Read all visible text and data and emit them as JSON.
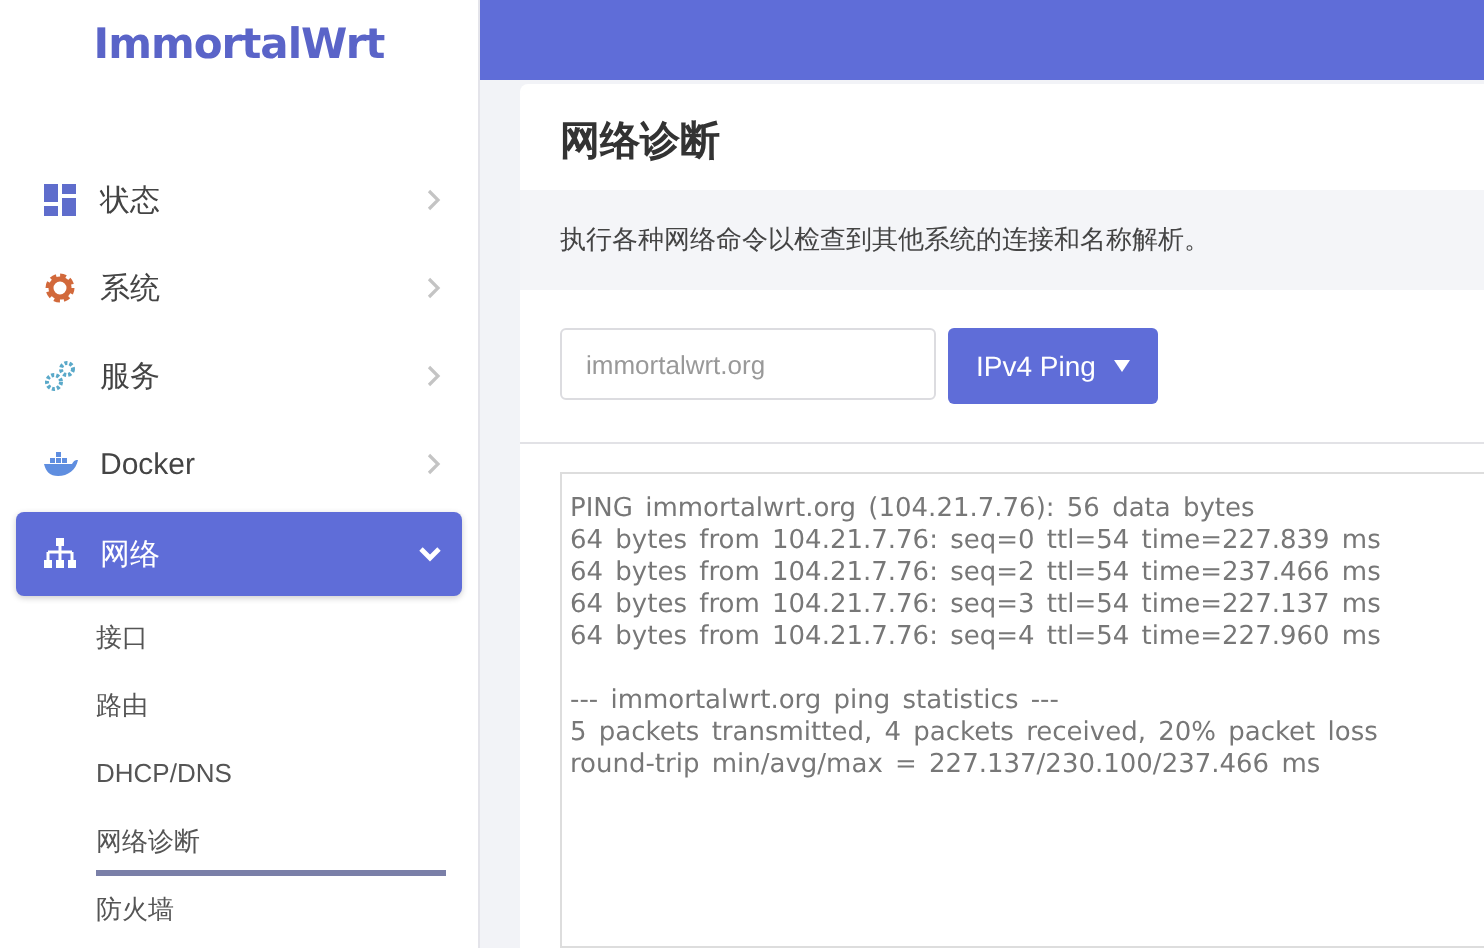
{
  "logo": "ImmortalWrt",
  "sidebar": {
    "items": [
      {
        "label": "状态",
        "expanded": false,
        "selected": false
      },
      {
        "label": "系统",
        "expanded": false,
        "selected": false
      },
      {
        "label": "服务",
        "expanded": false,
        "selected": false
      },
      {
        "label": "Docker",
        "expanded": false,
        "selected": false
      },
      {
        "label": "网络",
        "expanded": true,
        "selected": true,
        "children": [
          {
            "label": "接口",
            "selected": false
          },
          {
            "label": "路由",
            "selected": false
          },
          {
            "label": "DHCP/DNS",
            "selected": false
          },
          {
            "label": "网络诊断",
            "selected": true
          },
          {
            "label": "防火墙",
            "selected": false
          }
        ]
      }
    ]
  },
  "page": {
    "title": "网络诊断",
    "description": "执行各种网络命令以检查到其他系统的连接和名称解析。",
    "host_field": {
      "value": "immortalwrt.org"
    },
    "command_button": {
      "label": "IPv4 Ping"
    },
    "output": "PING immortalwrt.org (104.21.7.76): 56 data bytes\n64 bytes from 104.21.7.76: seq=0 ttl=54 time=227.839 ms\n64 bytes from 104.21.7.76: seq=2 ttl=54 time=237.466 ms\n64 bytes from 104.21.7.76: seq=3 ttl=54 time=227.137 ms\n64 bytes from 104.21.7.76: seq=4 ttl=54 time=227.960 ms\n\n--- immortalwrt.org ping statistics ---\n5 packets transmitted, 4 packets received, 20% packet loss\nround-trip min/avg/max = 227.137/230.100/237.466 ms"
  }
}
